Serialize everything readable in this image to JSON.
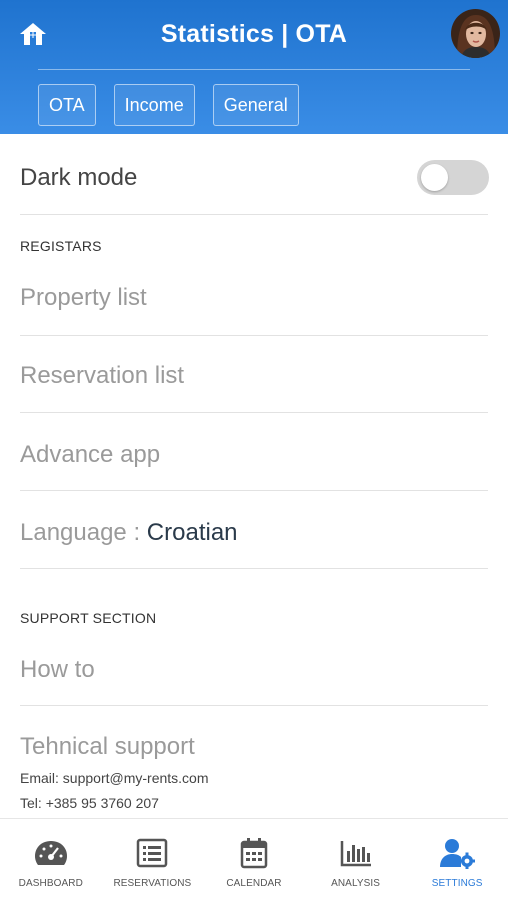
{
  "header": {
    "title": "Statistics | OTA",
    "tabs": [
      {
        "label": "OTA"
      },
      {
        "label": "Income"
      },
      {
        "label": "General"
      }
    ]
  },
  "settings": {
    "dark_mode": {
      "label": "Dark mode",
      "enabled": false
    },
    "registars_heading": "REGISTARS",
    "property_list": "Property list",
    "reservation_list": "Reservation list",
    "advance_app": "Advance app",
    "language": {
      "label": "Language : ",
      "value": "Croatian"
    },
    "support_heading": "SUPPORT SECTION",
    "how_to": "How to",
    "technical_support": {
      "label": "Tehnical support",
      "email_label": "Email: ",
      "email": "support@my-rents.com",
      "tel_label": "Tel: ",
      "tel": "+385 95 3760 207"
    }
  },
  "bottom_nav": {
    "items": [
      {
        "label": "DASHBOARD",
        "icon": "speedometer-icon"
      },
      {
        "label": "RESERVATIONS",
        "icon": "list-icon"
      },
      {
        "label": "CALENDAR",
        "icon": "calendar-icon"
      },
      {
        "label": "ANALYSIS",
        "icon": "bar-chart-icon"
      },
      {
        "label": "SETTINGS",
        "icon": "user-gear-icon"
      }
    ],
    "active": "SETTINGS"
  },
  "colors": {
    "header_blue": "#2a7fdc",
    "active_nav": "#2b7bd8",
    "toggle_off": "#d5d5d5"
  }
}
